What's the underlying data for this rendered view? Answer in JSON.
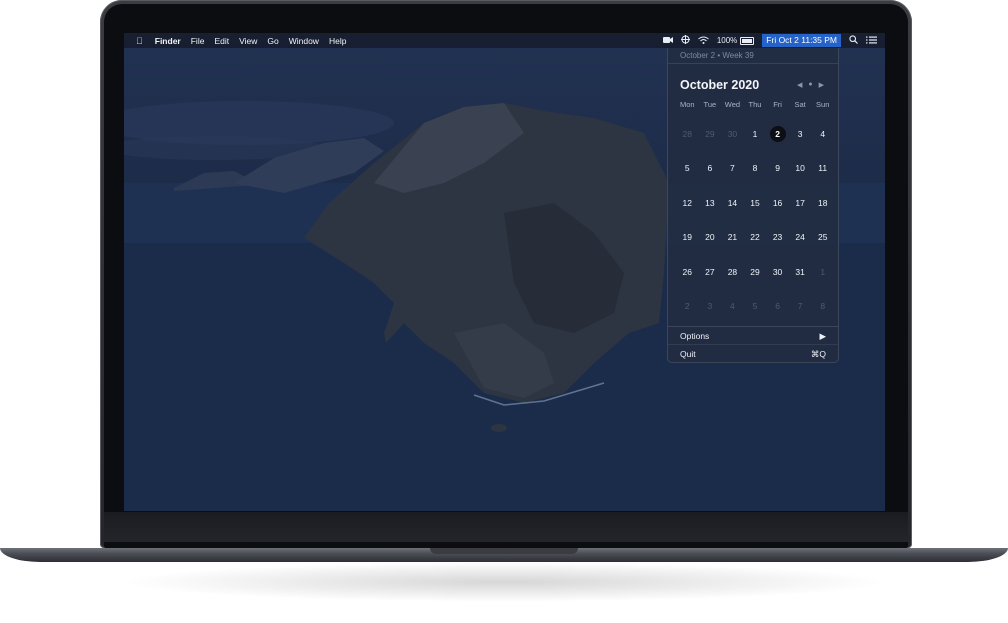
{
  "menubar": {
    "apple_icon": "apple-icon",
    "items": [
      "Finder",
      "File",
      "Edit",
      "View",
      "Go",
      "Window",
      "Help"
    ],
    "status": {
      "zoom_icon": "zoom-icon",
      "network_icon": "network-icon",
      "wifi_icon": "wifi-icon",
      "battery_percent": "100%",
      "clock": "Fri Oct 2 11:35 PM",
      "search_icon": "search-icon",
      "list_icon": "list-icon"
    }
  },
  "calendar": {
    "subtitle": "October 2 • Week 39",
    "month_title": "October 2020",
    "nav": {
      "prev": "◀",
      "today": "●",
      "next": "▶"
    },
    "weekdays": [
      "Mon",
      "Tue",
      "Wed",
      "Thu",
      "Fri",
      "Sat",
      "Sun"
    ],
    "weeks": [
      [
        {
          "d": "28",
          "m": true
        },
        {
          "d": "29",
          "m": true
        },
        {
          "d": "30",
          "m": true
        },
        {
          "d": "1"
        },
        {
          "d": "2",
          "today": true
        },
        {
          "d": "3"
        },
        {
          "d": "4"
        }
      ],
      [
        {
          "d": "5"
        },
        {
          "d": "6"
        },
        {
          "d": "7"
        },
        {
          "d": "8"
        },
        {
          "d": "9"
        },
        {
          "d": "10"
        },
        {
          "d": "11"
        }
      ],
      [
        {
          "d": "12"
        },
        {
          "d": "13"
        },
        {
          "d": "14"
        },
        {
          "d": "15"
        },
        {
          "d": "16"
        },
        {
          "d": "17"
        },
        {
          "d": "18"
        }
      ],
      [
        {
          "d": "19"
        },
        {
          "d": "20"
        },
        {
          "d": "21"
        },
        {
          "d": "22"
        },
        {
          "d": "23"
        },
        {
          "d": "24"
        },
        {
          "d": "25"
        }
      ],
      [
        {
          "d": "26"
        },
        {
          "d": "27"
        },
        {
          "d": "28"
        },
        {
          "d": "29"
        },
        {
          "d": "30"
        },
        {
          "d": "31"
        },
        {
          "d": "1",
          "m": true
        }
      ],
      [
        {
          "d": "2",
          "m": true
        },
        {
          "d": "3",
          "m": true
        },
        {
          "d": "4",
          "m": true
        },
        {
          "d": "5",
          "m": true
        },
        {
          "d": "6",
          "m": true
        },
        {
          "d": "7",
          "m": true
        },
        {
          "d": "8",
          "m": true
        }
      ]
    ],
    "options_label": "Options",
    "options_arrow": "▶",
    "quit_label": "Quit",
    "quit_shortcut": "⌘Q"
  },
  "colors": {
    "clock_highlight": "#2563c9",
    "popover_bg": "#222d42",
    "today_circle": "#0d0f14"
  }
}
